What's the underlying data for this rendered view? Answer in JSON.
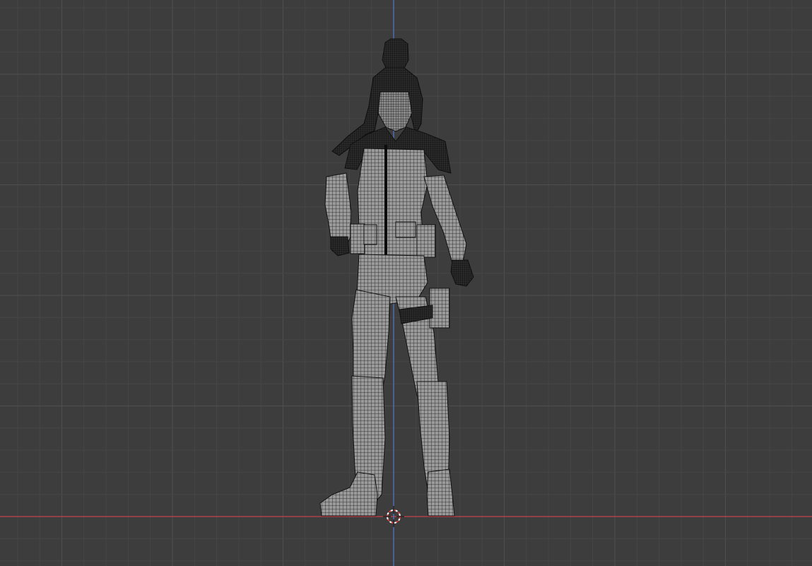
{
  "viewport": {
    "view": "front-orthographic",
    "shading": "wireframe",
    "background_color": "#3d3d3d",
    "grid": {
      "visible": true,
      "minor_color": "#464646",
      "major_color": "#4f4f4f"
    },
    "axes": {
      "x_axis_color": "#c6434d",
      "z_axis_color": "#4f7bd4"
    },
    "object": {
      "type": "character-mesh",
      "display": "wireframe",
      "fill_color": "#8e8e8e",
      "wire_color": "#1a1a1a"
    },
    "cursor": {
      "icon": "3d-cursor-icon",
      "ring_color_a": "#d63a3a",
      "ring_color_b": "#ffffff"
    }
  }
}
